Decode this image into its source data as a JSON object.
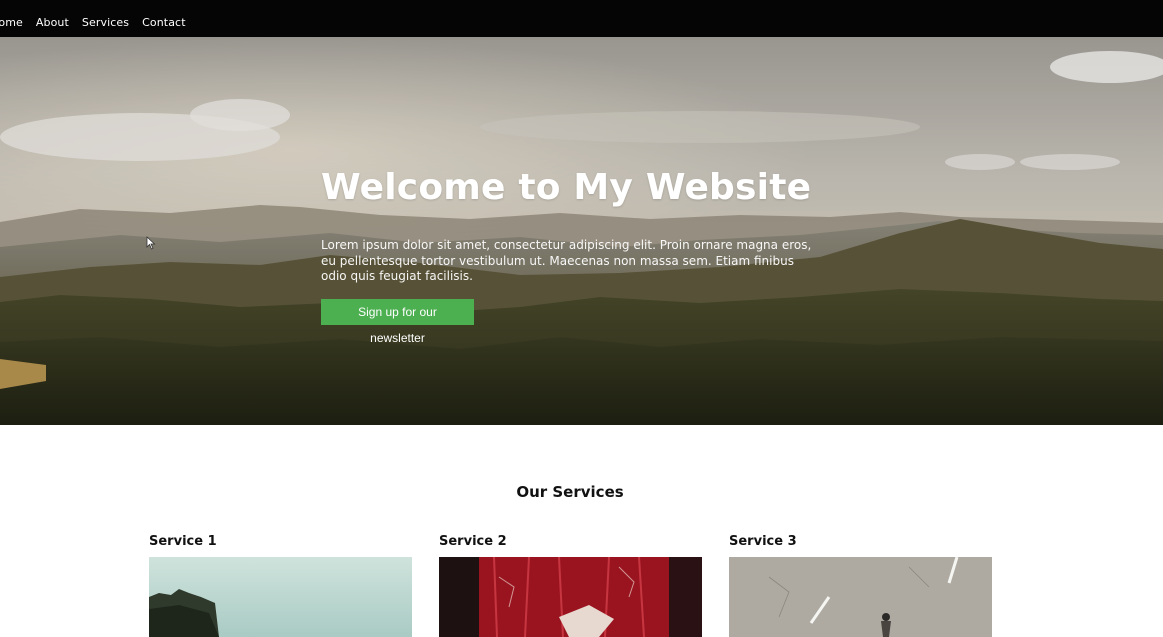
{
  "nav": {
    "items": [
      {
        "label": "Home"
      },
      {
        "label": "About"
      },
      {
        "label": "Services"
      },
      {
        "label": "Contact"
      }
    ]
  },
  "hero": {
    "title": "Welcome to My Website",
    "text": "Lorem ipsum dolor sit amet, consectetur adipiscing elit. Proin ornare magna eros, eu pellentesque tortor vestibulum ut. Maecenas non massa sem. Etiam finibus odio quis feugiat facilisis.",
    "button_label": "Sign up for our newsletter",
    "button_color": "#4caf50"
  },
  "services": {
    "title": "Our Services",
    "items": [
      {
        "title": "Service 1"
      },
      {
        "title": "Service 2"
      },
      {
        "title": "Service 3"
      }
    ]
  }
}
